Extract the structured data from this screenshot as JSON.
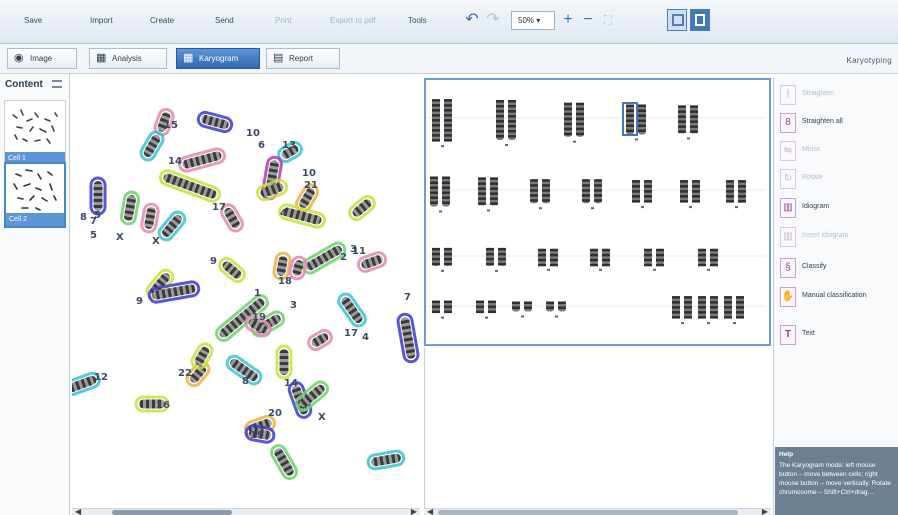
{
  "toolbar": {
    "buttons": [
      {
        "label": "Save",
        "enabled": true
      },
      {
        "label": "Import",
        "enabled": true
      },
      {
        "label": "Create",
        "enabled": true
      },
      {
        "label": "Send",
        "enabled": true
      },
      {
        "label": "Print",
        "enabled": false
      },
      {
        "label": "Export to pdf",
        "enabled": false
      },
      {
        "label": "Tools",
        "enabled": true
      }
    ],
    "undo_icon": "undo-icon",
    "redo_icon": "redo-icon",
    "zoom_value": "50% ▾",
    "zoom_in_icon": "zoom-in-icon",
    "zoom_out_icon": "zoom-out-icon",
    "fit_icon": "fit-to-window-icon"
  },
  "tabs": [
    {
      "label": "Image",
      "icon": "image-icon",
      "active": false
    },
    {
      "label": "Analysis",
      "icon": "analysis-icon",
      "active": false
    },
    {
      "label": "Karyogram",
      "icon": "karyogram-icon",
      "active": true
    },
    {
      "label": "Report",
      "icon": "report-icon",
      "active": false
    }
  ],
  "mode_label": "Karyotyping",
  "content": {
    "title": "Content",
    "thumbnails": [
      {
        "label": "Cell 1",
        "selected": false
      },
      {
        "label": "Cell 2",
        "selected": true
      }
    ]
  },
  "metaphase_labels": [
    "12",
    "15",
    "10",
    "13",
    "14",
    "6",
    "10",
    "21",
    "7",
    "8",
    "17",
    "4",
    "X",
    "5",
    "X",
    "11",
    "3",
    "2",
    "9",
    "18",
    "9",
    "1",
    "3",
    "19",
    "17",
    "4",
    "22",
    "8",
    "14",
    "16",
    "20",
    "19",
    "X",
    "5",
    "7"
  ],
  "tools": [
    {
      "label": "Straighten",
      "enabled": false
    },
    {
      "label": "Straighten all",
      "enabled": true
    },
    {
      "label": "Mirror",
      "enabled": false
    },
    {
      "label": "Rotate",
      "enabled": false
    },
    {
      "label": "Idiogram",
      "enabled": true
    },
    {
      "label": "Insert idiogram",
      "enabled": false
    },
    {
      "label": "Classify",
      "enabled": true
    },
    {
      "label": "Manual classification",
      "enabled": true
    },
    {
      "label": "Text",
      "enabled": true
    }
  ],
  "help": {
    "title": "Help",
    "text": "The Karyogram mode: left mouse button – move between cells; right mouse button – move vertically. Rotate chromosome – Shift+Ctrl+drag…"
  },
  "colors": {
    "accent": "#3f78bd",
    "panel_border": "#6b9ed6",
    "outline_colors": [
      "#35c4d4",
      "#c8e03a",
      "#e08ab0",
      "#6bd46b",
      "#f0b040",
      "#3a3ad0",
      "#b03ab0"
    ]
  }
}
